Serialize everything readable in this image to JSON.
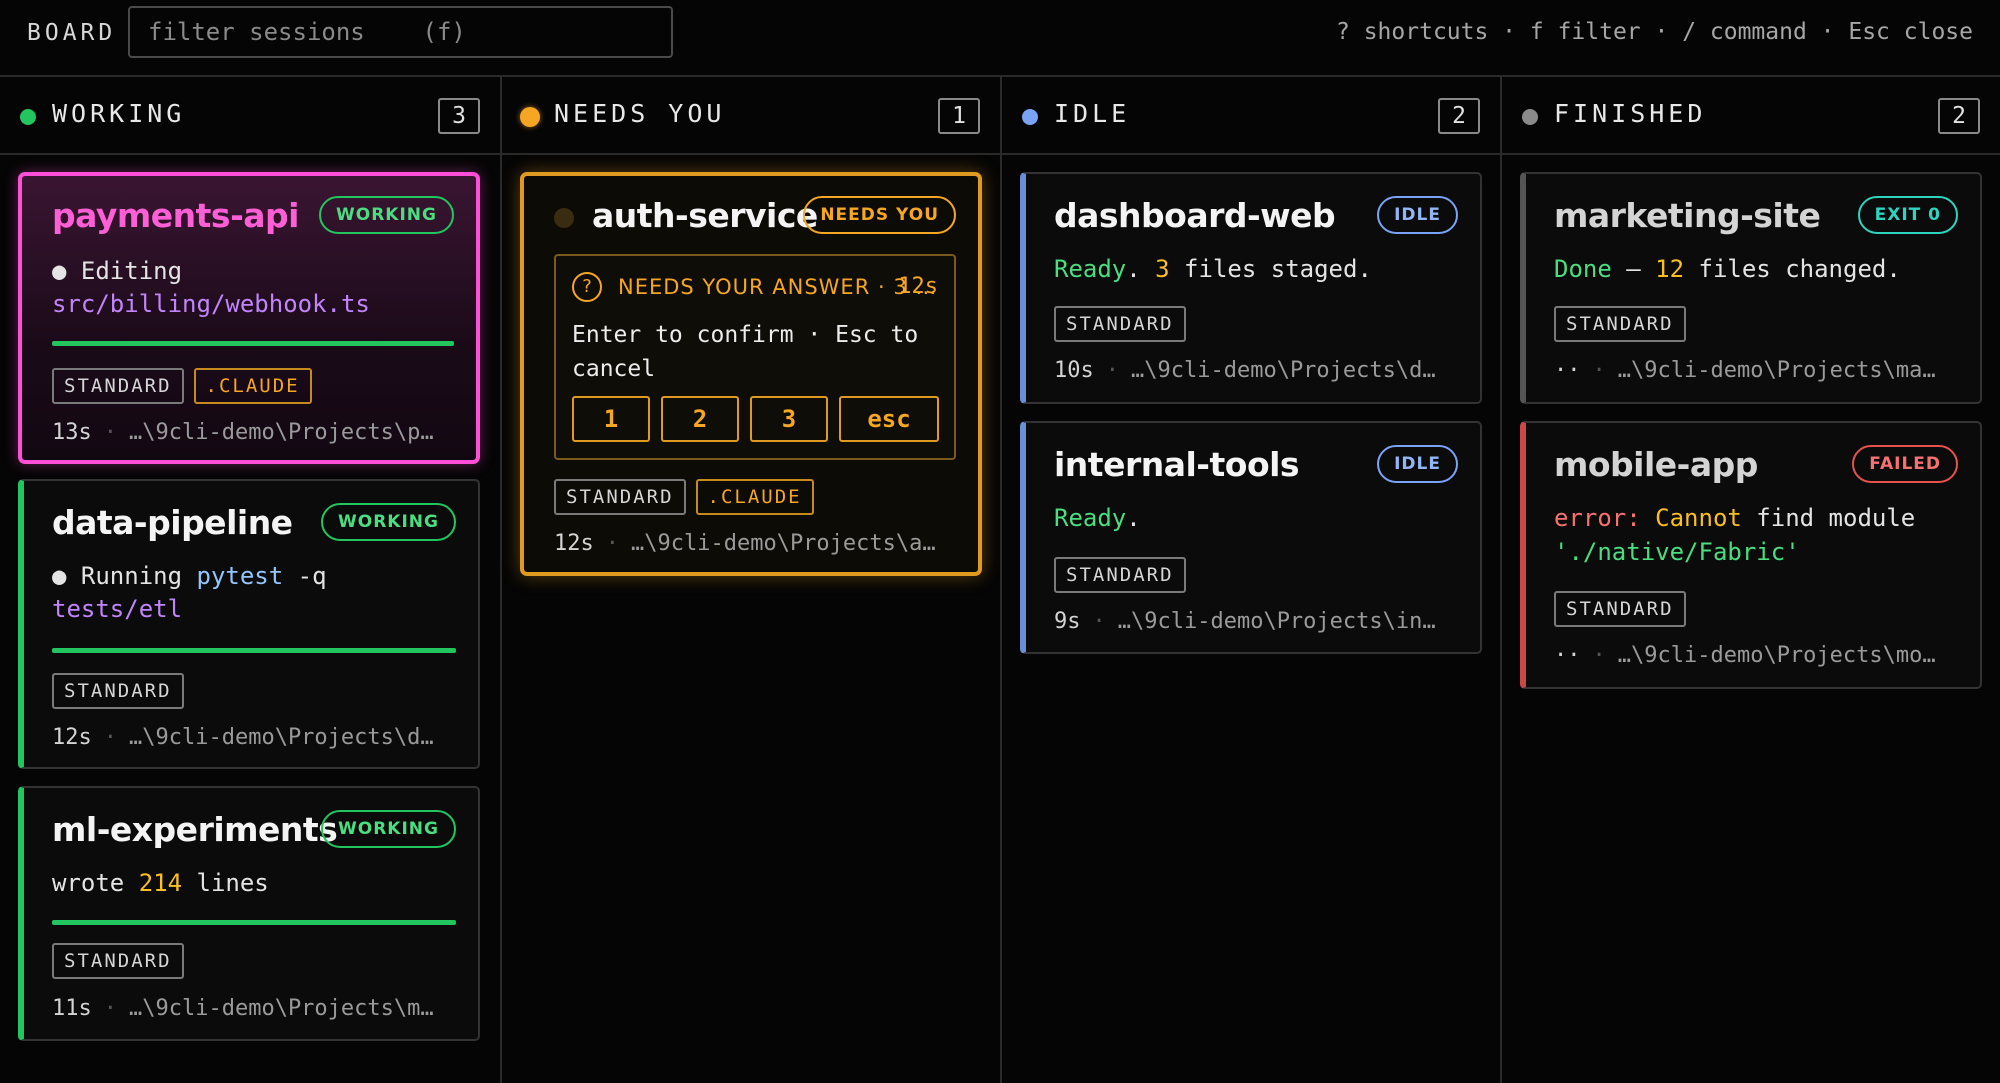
{
  "app": {
    "brand": "BOARD"
  },
  "search": {
    "placeholder": "filter sessions    (f)"
  },
  "hints": "? shortcuts · f filter · / command · Esc close",
  "colors": {
    "working": "#22c55e",
    "needs": "#f5a623",
    "idle": "#7aa2f7",
    "finished": "#8a8a8a",
    "failed": "#e5534b",
    "exit": "#2dd4bf",
    "active_card": "#ff4fd8"
  },
  "columns": [
    {
      "title": "WORKING",
      "count": "3"
    },
    {
      "title": "NEEDS YOU",
      "count": "1"
    },
    {
      "title": "IDLE",
      "count": "2"
    },
    {
      "title": "FINISHED",
      "count": "2"
    }
  ],
  "cards": {
    "payments": {
      "name": "payments-api",
      "badge": "WORKING",
      "line1": "● Editing",
      "line2": "src/billing/webhook.ts",
      "progress": 1.0,
      "tags": [
        "STANDARD",
        ".CLAUDE"
      ],
      "time": "13s",
      "path": "…\\9cli-demo\\Projects\\p…"
    },
    "pipeline": {
      "name": "data-pipeline",
      "badge": "WORKING",
      "line1_a": "● Running ",
      "line1_b": "pytest",
      "line1_c": " -q",
      "line2": "tests/etl",
      "progress": 1.0,
      "tags": [
        "STANDARD"
      ],
      "time": "12s",
      "path": "…\\9cli-demo\\Projects\\d…"
    },
    "ml": {
      "name": "ml-experiments",
      "badge": "WORKING",
      "line1_a": "wrote ",
      "line1_b": "214",
      "line1_c": " lines",
      "progress": 1.0,
      "tags": [
        "STANDARD"
      ],
      "time": "11s",
      "path": "…\\9cli-demo\\Projects\\m…"
    },
    "auth": {
      "name": "auth-service",
      "badge": "NEEDS YOU",
      "question": {
        "icon": "?",
        "title": "NEEDS YOUR ANSWER · 3 …",
        "time": "12s",
        "text": "Enter to confirm · Esc to cancel",
        "buttons": [
          "1",
          "2",
          "3",
          "esc"
        ]
      },
      "tags": [
        "STANDARD",
        ".CLAUDE"
      ],
      "time": "12s",
      "path": "…\\9cli-demo\\Projects\\a…"
    },
    "dashboard": {
      "name": "dashboard-web",
      "badge": "IDLE",
      "line1_a": "Ready",
      "line1_b": ". ",
      "line1_c": "3",
      "line1_d": " files staged.",
      "tags": [
        "STANDARD"
      ],
      "time": "10s",
      "path": "…\\9cli-demo\\Projects\\d…"
    },
    "internal": {
      "name": "internal-tools",
      "badge": "IDLE",
      "line1_a": "Ready",
      "line1_b": ".",
      "tags": [
        "STANDARD"
      ],
      "time": "9s",
      "path": "…\\9cli-demo\\Projects\\in…"
    },
    "marketing": {
      "name": "marketing-site",
      "badge": "EXIT 0",
      "line1_a": "Done",
      "line1_b": " — ",
      "line1_c": "12",
      "line1_d": " files changed.",
      "tags": [
        "STANDARD"
      ],
      "time": "··",
      "path": "…\\9cli-demo\\Projects\\ma…"
    },
    "mobile": {
      "name": "mobile-app",
      "badge": "FAILED",
      "line1_a": "error:",
      "line1_b": " Cannot",
      "line1_c": " find module",
      "line2": "'./native/Fabric'",
      "tags": [
        "STANDARD"
      ],
      "time": "··",
      "path": "…\\9cli-demo\\Projects\\mo…"
    }
  }
}
